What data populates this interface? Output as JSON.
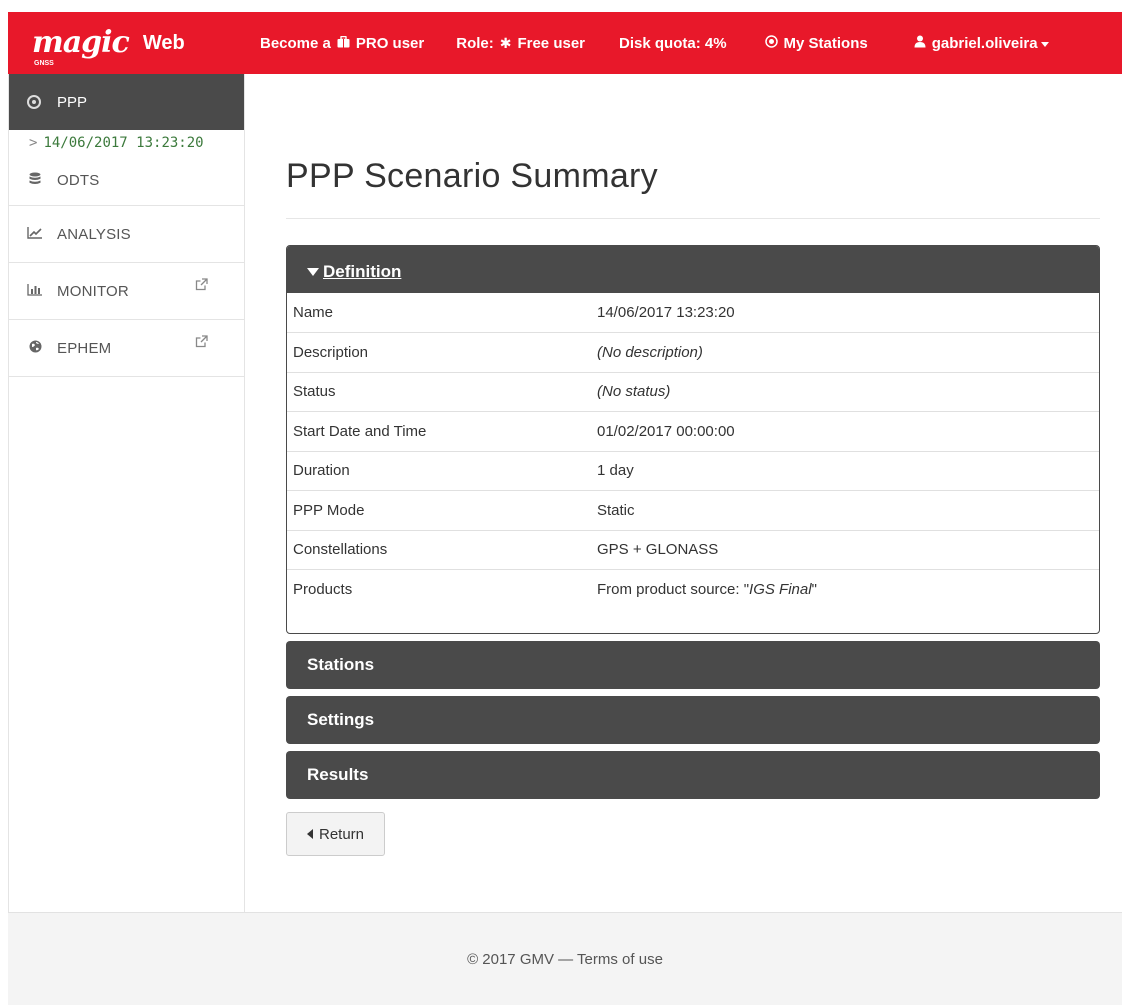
{
  "brand": {
    "logo": "magic",
    "logo_sub": "GNSS",
    "web": "Web"
  },
  "navbar": {
    "become_prefix": "Become a",
    "become_suffix": "PRO user",
    "role_label": "Role:",
    "role_value": "Free user",
    "disk_quota": "Disk quota: 4%",
    "my_stations": "My Stations",
    "user": "gabriel.oliveira"
  },
  "sidebar": {
    "active": {
      "label": "PPP",
      "icon": "ppp-target-icon"
    },
    "sub_item": "14/06/2017 13:23:20",
    "items": [
      {
        "label": "ODTS",
        "icon": "database-icon"
      },
      {
        "label": "ANALYSIS",
        "icon": "line-chart-icon"
      },
      {
        "label": "MONITOR",
        "icon": "bar-chart-icon",
        "external": true
      },
      {
        "label": "EPHEM",
        "icon": "globe-icon",
        "external": true
      }
    ]
  },
  "main": {
    "title": "PPP Scenario Summary",
    "definition": {
      "heading": "Definition",
      "rows": [
        {
          "key": "Name",
          "value": "14/06/2017 13:23:20"
        },
        {
          "key": "Description",
          "value": "(No description)"
        },
        {
          "key": "Status",
          "value": "(No status)"
        },
        {
          "key": "Start Date and Time",
          "value": "01/02/2017 00:00:00"
        },
        {
          "key": "Duration",
          "value": "1 day"
        },
        {
          "key": "PPP Mode",
          "value": "Static"
        },
        {
          "key": "Constellations",
          "value": "GPS + GLONASS"
        },
        {
          "key": "Products",
          "value_prefix": "From product source: \"",
          "value_italic": "IGS Final",
          "value_suffix": "\""
        }
      ]
    },
    "collapsed_panels": [
      "Stations",
      "Settings",
      "Results"
    ],
    "return_label": "Return"
  },
  "footer": {
    "text": "© 2017 GMV — Terms of use"
  },
  "colors": {
    "navbar_red": "#e8182a",
    "panel_dark": "#4a4a4a",
    "sub_item_green": "#3c7a3c"
  }
}
